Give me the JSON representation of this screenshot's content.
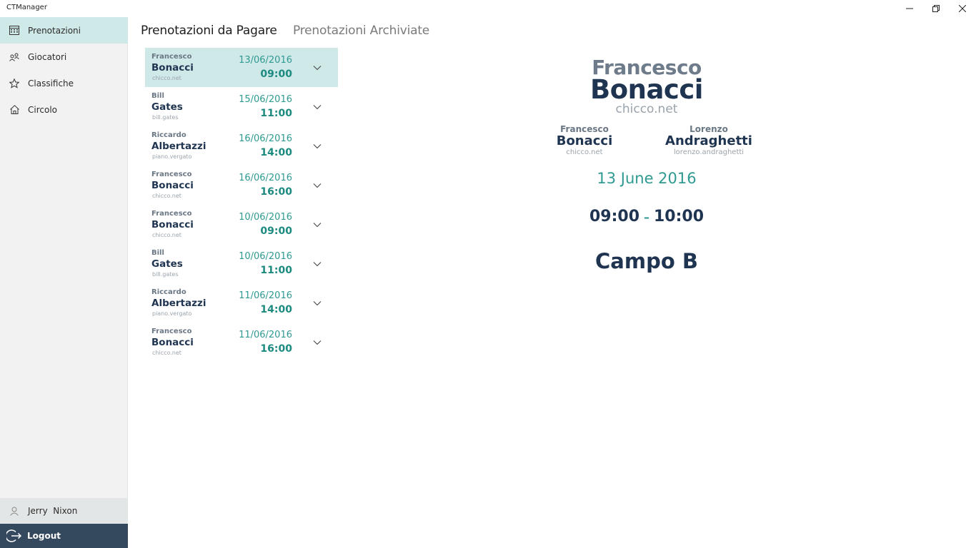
{
  "window": {
    "title": "CTManager",
    "controls": [
      "minimize-icon",
      "restore-icon",
      "close-icon"
    ]
  },
  "sidebar": {
    "items": [
      {
        "label": "Prenotazioni",
        "icon": "calendar-icon",
        "active": true
      },
      {
        "label": "Giocatori",
        "icon": "people-icon",
        "active": false
      },
      {
        "label": "Classifiche",
        "icon": "star-icon",
        "active": false
      },
      {
        "label": "Circolo",
        "icon": "home-icon",
        "active": false
      }
    ],
    "user": {
      "name": "Jerry  Nixon",
      "icon": "user-icon"
    },
    "logout": {
      "label": "Logout",
      "icon": "logout-icon"
    }
  },
  "tabs": [
    {
      "label": "Prenotazioni da Pagare",
      "active": true
    },
    {
      "label": "Prenotazioni Archiviate",
      "active": false
    }
  ],
  "bookings": [
    {
      "first": "Francesco",
      "last": "Bonacci",
      "user": "chicco.net",
      "date": "13/06/2016",
      "time": "09:00",
      "selected": true
    },
    {
      "first": "Bill",
      "last": "Gates",
      "user": "bill.gates",
      "date": "15/06/2016",
      "time": "11:00",
      "selected": false
    },
    {
      "first": "Riccardo",
      "last": "Albertazzi",
      "user": "piano.vergato",
      "date": "16/06/2016",
      "time": "14:00",
      "selected": false
    },
    {
      "first": "Francesco",
      "last": "Bonacci",
      "user": "chicco.net",
      "date": "16/06/2016",
      "time": "16:00",
      "selected": false
    },
    {
      "first": "Francesco",
      "last": "Bonacci",
      "user": "chicco.net",
      "date": "10/06/2016",
      "time": "09:00",
      "selected": false
    },
    {
      "first": "Bill",
      "last": "Gates",
      "user": "bill.gates",
      "date": "10/06/2016",
      "time": "11:00",
      "selected": false
    },
    {
      "first": "Riccardo",
      "last": "Albertazzi",
      "user": "piano.vergato",
      "date": "11/06/2016",
      "time": "14:00",
      "selected": false
    },
    {
      "first": "Francesco",
      "last": "Bonacci",
      "user": "chicco.net",
      "date": "11/06/2016",
      "time": "16:00",
      "selected": false
    }
  ],
  "detail": {
    "first": "Francesco",
    "last": "Bonacci",
    "user": "chicco.net",
    "players": [
      {
        "first": "Francesco",
        "last": "Bonacci",
        "user": "chicco.net"
      },
      {
        "first": "Lorenzo",
        "last": "Andraghetti",
        "user": "lorenzo.andraghetti"
      }
    ],
    "date": "13 June 2016",
    "start": "09:00",
    "separator": "–",
    "end": "10:00",
    "court": "Campo B"
  },
  "colors": {
    "accent": "#2f9a91",
    "selection": "#cfe8e8",
    "dark_text": "#1f3450",
    "logout_bg": "#34495e"
  }
}
